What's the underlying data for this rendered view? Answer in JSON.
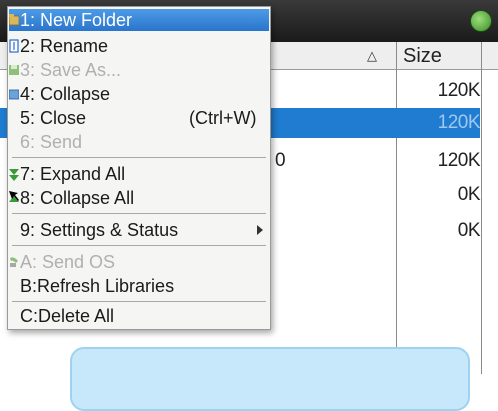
{
  "list": {
    "header": {
      "size_label": "Size"
    },
    "rows": [
      {
        "name": "",
        "size": "120K",
        "selected": false
      },
      {
        "name": "",
        "size": "120K",
        "selected": true
      },
      {
        "name": "0",
        "size": "120K",
        "selected": false
      },
      {
        "name": "",
        "size": "0K",
        "selected": false
      },
      {
        "name": "",
        "size": "0K",
        "selected": false
      }
    ]
  },
  "menu": {
    "items": [
      {
        "label": "1: New Folder",
        "state": "highlighted",
        "icon": "new-folder-icon"
      },
      {
        "label": "2: Rename",
        "state": "enabled",
        "icon": "rename-icon"
      },
      {
        "label": "3: Save As...",
        "state": "disabled",
        "icon": "save-as-icon"
      },
      {
        "label": "4: Collapse",
        "state": "enabled",
        "icon": "collapse-icon"
      },
      {
        "label": "5: Close",
        "shortcut": "(Ctrl+W)",
        "state": "enabled"
      },
      {
        "label": "6: Send",
        "state": "disabled"
      },
      {
        "label": "7: Expand All",
        "state": "enabled",
        "icon": "expand-all-icon"
      },
      {
        "label": "8: Collapse All",
        "state": "enabled",
        "icon": "collapse-all-icon"
      },
      {
        "label": "9: Settings & Status",
        "state": "enabled",
        "submenu": true
      },
      {
        "label": "A: Send OS",
        "state": "disabled",
        "icon": "send-os-icon"
      },
      {
        "label": "B:Refresh Libraries",
        "state": "enabled"
      },
      {
        "label": "C:Delete All",
        "state": "enabled"
      }
    ]
  },
  "colors": {
    "menu_highlight": "#2a75cc",
    "row_selected": "#1f7cd0",
    "panel_fill": "#c7e8fb",
    "titlebar": "#1a1a1a"
  }
}
